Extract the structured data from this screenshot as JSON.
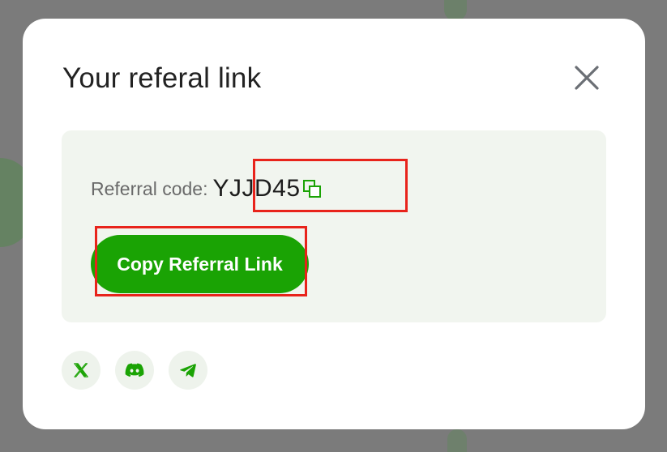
{
  "modal": {
    "title": "Your referal link",
    "close_label": "Close"
  },
  "referral": {
    "label": "Referral code:",
    "code": "YJJD45",
    "copy_icon": "copy-icon"
  },
  "actions": {
    "copy_link_label": "Copy Referral Link"
  },
  "socials": [
    {
      "name": "X",
      "icon": "x-icon"
    },
    {
      "name": "Discord",
      "icon": "discord-icon"
    },
    {
      "name": "Telegram",
      "icon": "telegram-icon"
    }
  ],
  "colors": {
    "accent": "#1aa304",
    "panel_bg": "#f1f5ef",
    "highlight": "#e8231b",
    "overlay": "#7b7b7b"
  }
}
